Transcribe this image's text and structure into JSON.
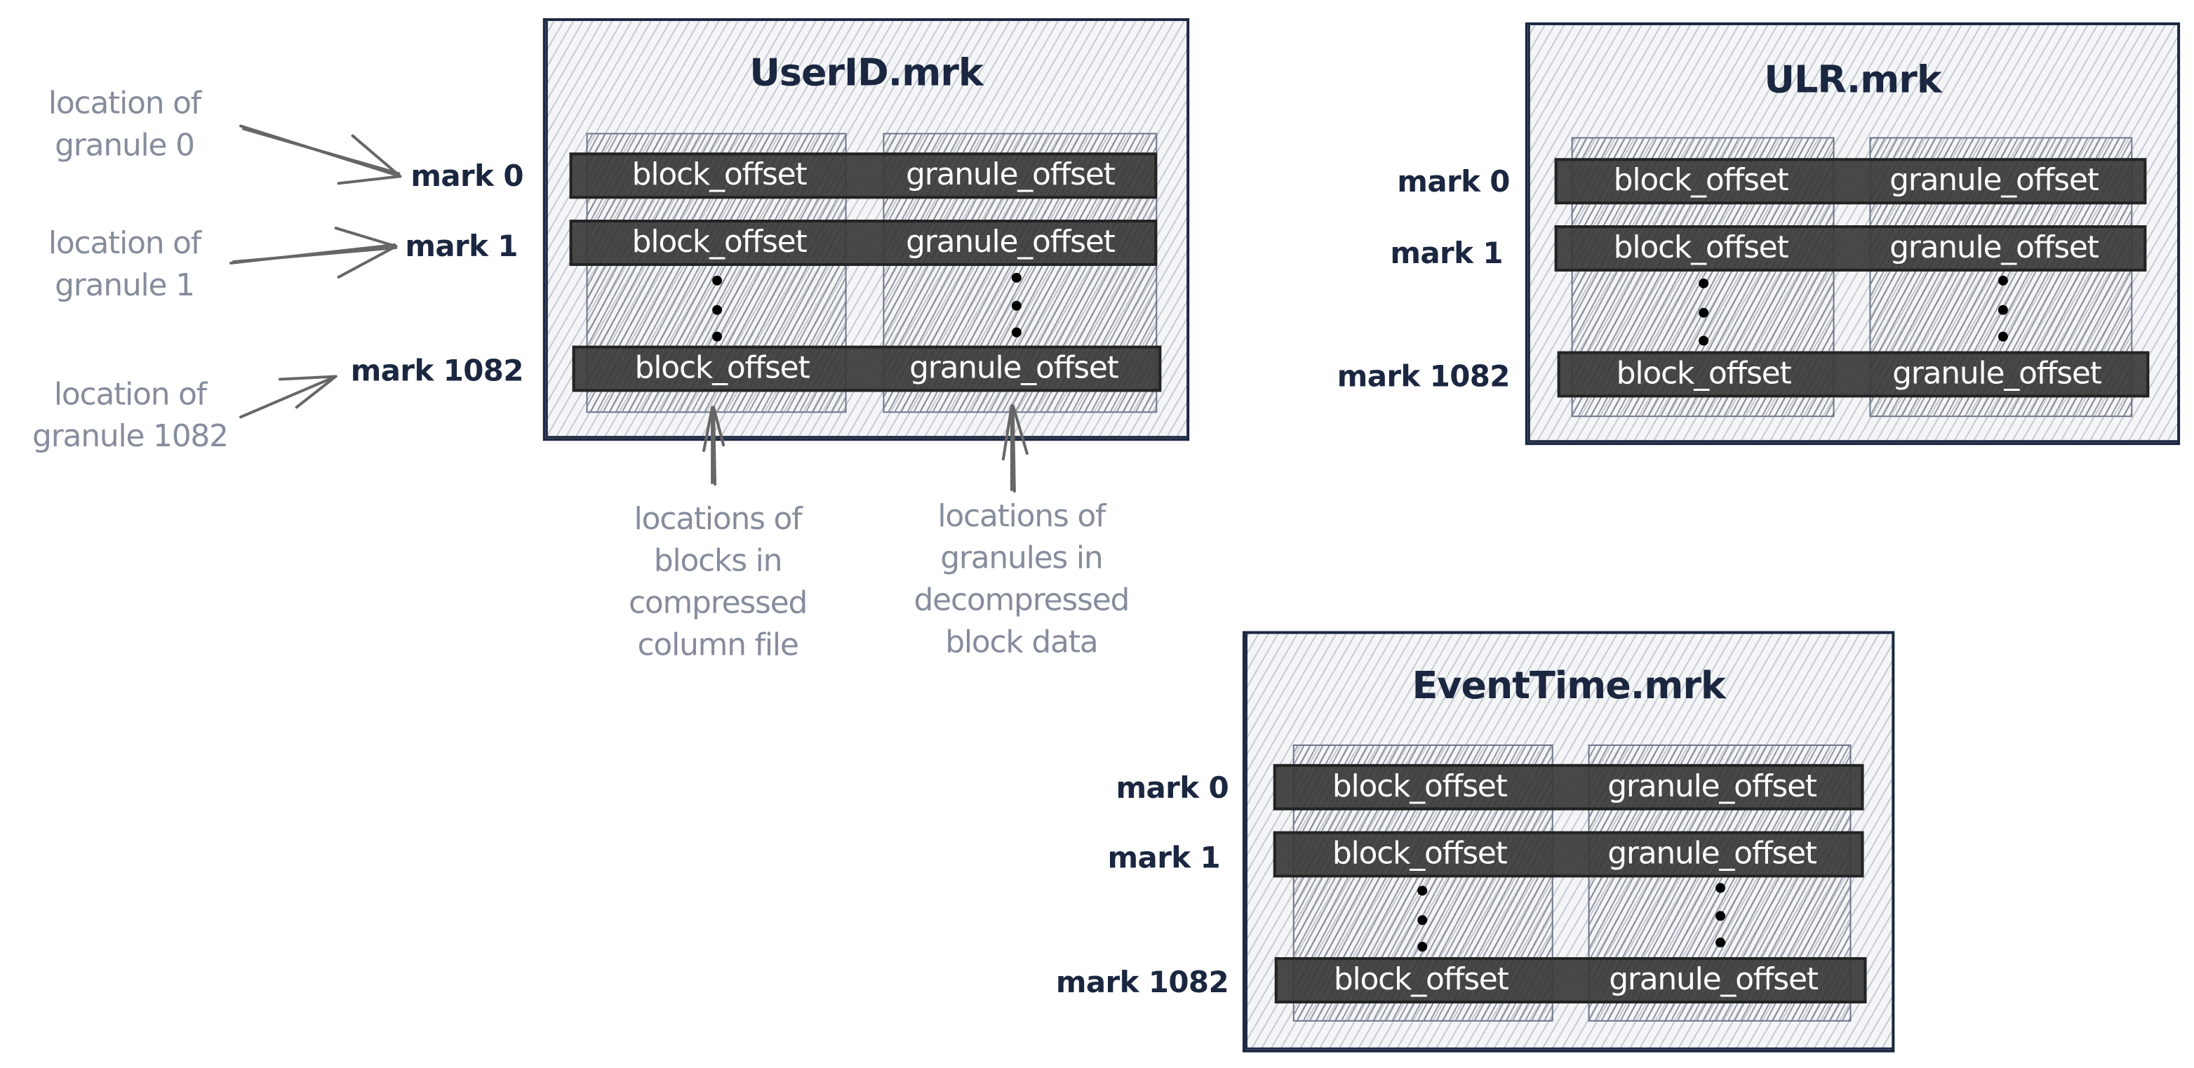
{
  "colors": {
    "ink": "#1b2740",
    "annotation_text": "#868c9c",
    "row_fill": "#3a3a3a",
    "row_text": "#ffffff",
    "arrow": "#666666",
    "hatch": "#a0a8b4"
  },
  "mark_files": [
    {
      "title": "UserID.mrk",
      "rows": [
        {
          "mark": "mark 0",
          "block": "block_offset",
          "granule": "granule_offset"
        },
        {
          "mark": "mark 1",
          "block": "block_offset",
          "granule": "granule_offset"
        },
        {
          "mark": "mark 1082",
          "block": "block_offset",
          "granule": "granule_offset"
        }
      ]
    },
    {
      "title": "ULR.mrk",
      "rows": [
        {
          "mark": "mark 0",
          "block": "block_offset",
          "granule": "granule_offset"
        },
        {
          "mark": "mark 1",
          "block": "block_offset",
          "granule": "granule_offset"
        },
        {
          "mark": "mark 1082",
          "block": "block_offset",
          "granule": "granule_offset"
        }
      ]
    },
    {
      "title": "EventTime.mrk",
      "rows": [
        {
          "mark": "mark 0",
          "block": "block_offset",
          "granule": "granule_offset"
        },
        {
          "mark": "mark 1",
          "block": "block_offset",
          "granule": "granule_offset"
        },
        {
          "mark": "mark 1082",
          "block": "block_offset",
          "granule": "granule_offset"
        }
      ]
    }
  ],
  "annotations": {
    "granule_0": "location of\ngranule 0",
    "granule_1": "location of\ngranule 1",
    "granule_1082": "location of\ngranule 1082",
    "blocks": "locations of\nblocks in\ncompressed\ncolumn file",
    "granules": "locations of\ngranules in\ndecompressed\nblock data"
  }
}
